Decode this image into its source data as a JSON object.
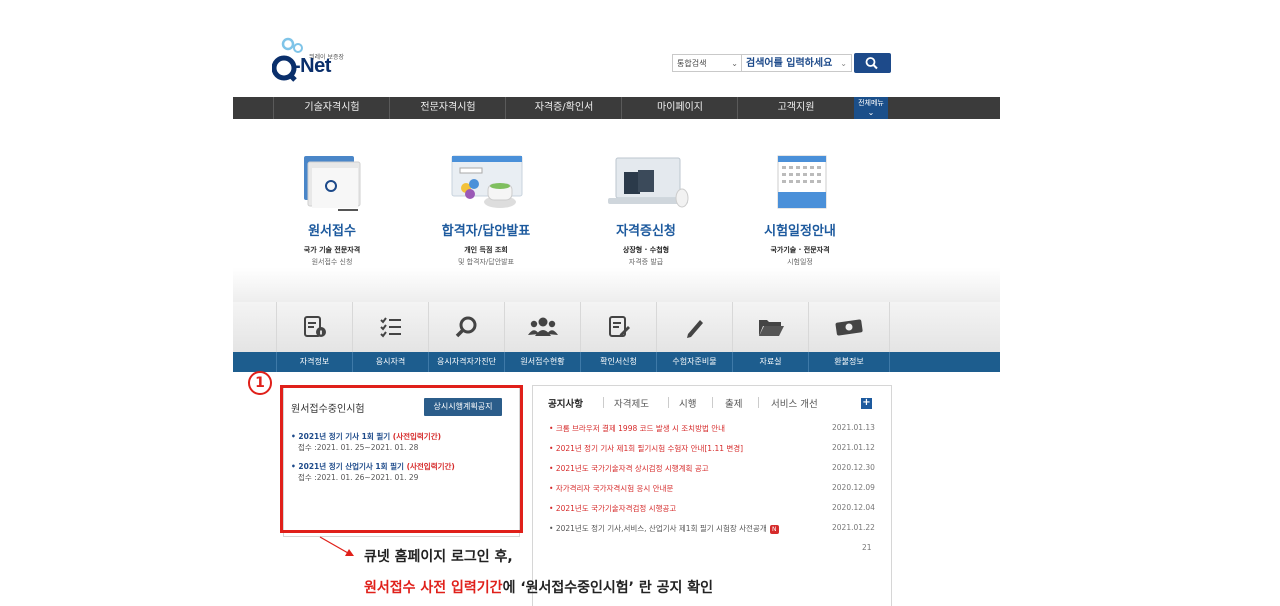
{
  "header": {
    "logo_small": "뷔레이 보증장",
    "logo_text": "Q-Net",
    "search_category": "통합검색",
    "search_placeholder": "검색어를 입력하세요"
  },
  "gnb": {
    "items": [
      "기술자격시험",
      "전문자격시험",
      "자격증/확인서",
      "마이페이지",
      "고객지원"
    ],
    "all_menu": "전체메뉴"
  },
  "quick": [
    {
      "title": "원서접수",
      "sub1": "국가 기술 전문자격",
      "sub2": "원서접수 신청"
    },
    {
      "title": "합격자/답안발표",
      "sub1": "개인 득점 조회",
      "sub2": "및 합격자/답안발표"
    },
    {
      "title": "자격증신청",
      "sub1": "상장형 · 수첩형",
      "sub2": "자격증 발급"
    },
    {
      "title": "시험일정안내",
      "sub1": "국가기술 · 전문자격",
      "sub2": "시험일정"
    }
  ],
  "icon_menu": [
    "자격정보",
    "응시자격",
    "응시자격자가진단",
    "원서접수현황",
    "확인서신청",
    "수험자준비물",
    "자료실",
    "환불정보"
  ],
  "left_panel": {
    "title": "원서접수중인시험",
    "button": "상시시행계획공지",
    "exams": [
      {
        "title": "2021년 정기 기사 1회 필기",
        "tag": "(사전입력기간)",
        "period": "접수 :2021. 01. 25~2021. 01. 28"
      },
      {
        "title": "2021년 정기 산업기사 1회 필기",
        "tag": "(사전입력기간)",
        "period": "접수 :2021. 01. 26~2021. 01. 29"
      }
    ]
  },
  "marker": "1",
  "right_panel": {
    "tabs": [
      "공지사항",
      "자격제도",
      "시행",
      "출제",
      "서비스 개선"
    ],
    "more": "+",
    "notices": [
      {
        "text": "크롬 브라우저 결제 1998 코드 발생 시 조치방법 안내",
        "date": "2021.01.13"
      },
      {
        "text": "2021년 정기 기사 제1회 필기시험 수험자 안내[1.11 변경]",
        "date": "2021.01.12"
      },
      {
        "text": "2021년도 국가기술자격 상시검정 시행계획 공고",
        "date": "2020.12.30"
      },
      {
        "text": "자가격리자 국가자격시험 응시 안내문",
        "date": "2020.12.09"
      },
      {
        "text": "2021년도 국가기술자격검정 시행공고",
        "date": "2020.12.04"
      },
      {
        "text": "2021년도 정기 기사,서비스, 산업기사 제1회 필기 시험장 사전공개",
        "date": "2021.01.22",
        "badge": "N"
      }
    ],
    "extra": [
      "21"
    ]
  },
  "annotation": {
    "line1": "큐넷 홈페이지 로그인 후,",
    "line2_red": "원서접수 사전 입력기간",
    "line2_rest": "에 ‘원서접수중인시험’ 란 공지 확인"
  },
  "colors": {
    "brand_blue": "#1d4a8a",
    "gnb_dark": "#3b3b3b",
    "label_bar": "#1d5d8e",
    "highlight_red": "#e0201a"
  }
}
